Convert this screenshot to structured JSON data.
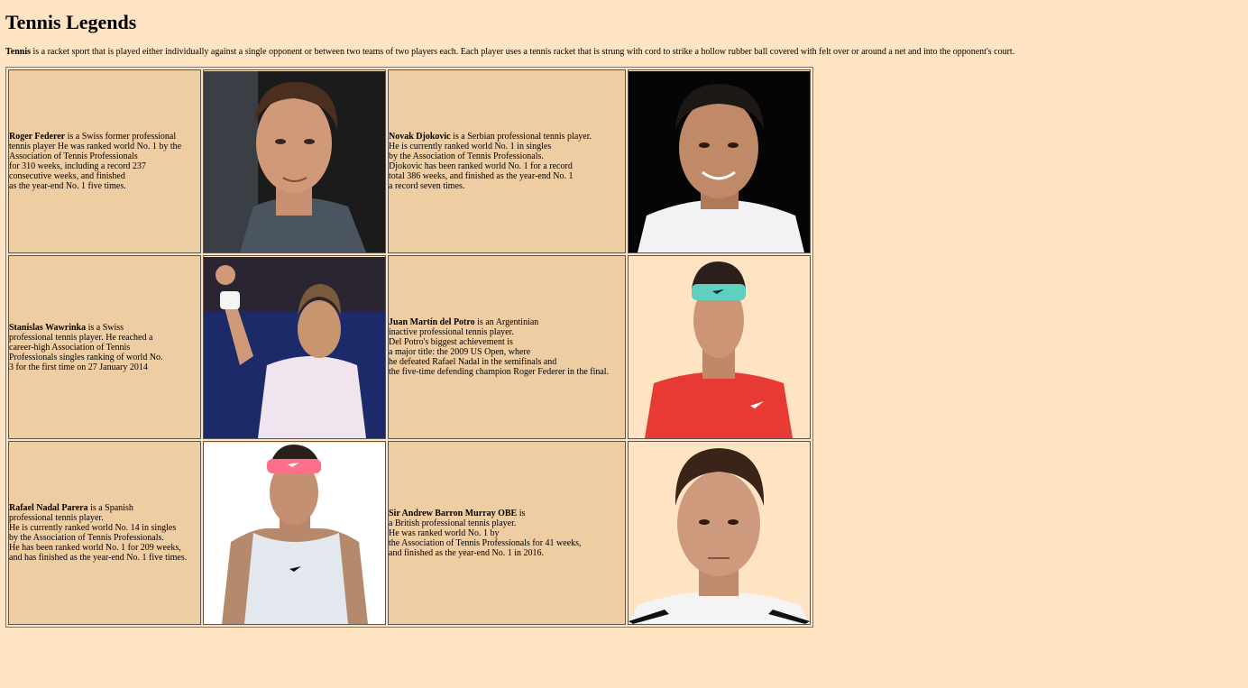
{
  "page": {
    "title": "Tennis Legends",
    "intro_bold": "Tennis",
    "intro_rest": " is a racket sport that is played either individually against a single opponent or between two teams of two players each. Each player uses a tennis racket that is strung with cord to strike a hollow rubber ball covered with felt over or around a net and into the opponent's court."
  },
  "players": [
    {
      "name": "Roger Federer",
      "lines": [
        " is a Swiss former professional",
        "tennis player He was ranked world No. 1 by the",
        "Association of Tennis Professionals",
        "for 310 weeks, including a record 237",
        "consecutive weeks, and finished",
        "as the year-end No. 1 five times."
      ],
      "photo_icon": "portrait-federer"
    },
    {
      "name": "Novak Djokovic",
      "lines": [
        " is a Serbian professional tennis player.",
        "He is currently ranked world No. 1 in singles",
        "by the Association of Tennis Professionals.",
        "Djokovic has been ranked world No. 1 for a record",
        "total 386 weeks, and finished as the year-end No. 1",
        "a record seven times."
      ],
      "photo_icon": "portrait-djokovic"
    },
    {
      "name": "Stanislas Wawrinka",
      "lines": [
        " is a Swiss",
        "professional tennis player. He reached a",
        "career-high Association of Tennis",
        "Professionals singles ranking of world No.",
        "3 for the first time on 27 January 2014"
      ],
      "photo_icon": "portrait-wawrinka"
    },
    {
      "name": "Juan Martín del Potro",
      "lines": [
        " is an Argentinian",
        "inactive professional tennis player.",
        "Del Potro's biggest achievement is",
        "a major title: the 2009 US Open, where",
        "he defeated Rafael Nadal in the semifinals and",
        "the five-time defending champion Roger Federer in the final."
      ],
      "photo_icon": "portrait-del-potro"
    },
    {
      "name": "Rafael Nadal Parera",
      "lines": [
        " is a Spanish",
        "professional tennis player.",
        "He is currently ranked world No. 14 in singles",
        "by the Association of Tennis Professionals.",
        "He has been ranked world No. 1 for 209 weeks,",
        "and has finished as the year-end No. 1 five times."
      ],
      "photo_icon": "portrait-nadal"
    },
    {
      "name": "Sir Andrew Barron Murray OBE",
      "lines": [
        " is",
        "a British professional tennis player.",
        "He was ranked world No. 1 by",
        "the Association of Tennis Professionals for 41 weeks,",
        "and finished as the year-end No. 1 in 2016."
      ],
      "photo_icon": "portrait-murray"
    }
  ],
  "colors": {
    "page_bg": "#ffe4c4",
    "cell_bg": "#eecda3"
  }
}
